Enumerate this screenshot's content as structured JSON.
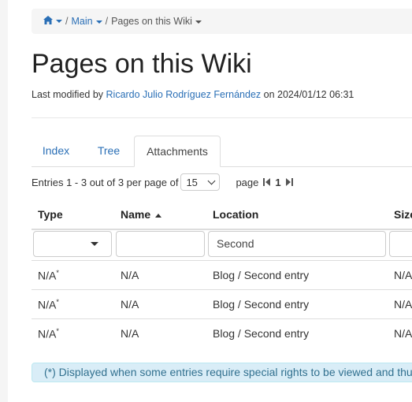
{
  "breadcrumb": {
    "home_label": "",
    "main_label": "Main",
    "current_label": "Pages on this Wiki",
    "separator": "/"
  },
  "page_title": "Pages on this Wiki",
  "modified": {
    "prefix": "Last modified by",
    "author": "Ricardo Julio Rodríguez Fernández",
    "on_label": "on",
    "timestamp": "2024/01/12 06:31"
  },
  "tabs": [
    {
      "label": "Index",
      "active": false
    },
    {
      "label": "Tree",
      "active": false
    },
    {
      "label": "Attachments",
      "active": true
    }
  ],
  "pagination": {
    "entries_text": "Entries 1 - 3 out of 3 per page of",
    "per_page": "15",
    "page_label": "page",
    "current_page": "1"
  },
  "table": {
    "columns": [
      {
        "label": "Type"
      },
      {
        "label": "Name",
        "sorted": "asc"
      },
      {
        "label": "Location"
      },
      {
        "label": "Size"
      }
    ],
    "filters": {
      "type": "",
      "name": "",
      "location": "Second",
      "size": ""
    },
    "rows": [
      {
        "type": "N/A",
        "type_mark": "*",
        "name": "N/A",
        "location": "Blog / Second entry",
        "size": "N/A"
      },
      {
        "type": "N/A",
        "type_mark": "*",
        "name": "N/A",
        "location": "Blog / Second entry",
        "size": "N/A"
      },
      {
        "type": "N/A",
        "type_mark": "*",
        "name": "N/A",
        "location": "Blog / Second entry",
        "size": "N/A"
      }
    ]
  },
  "note": "(*) Displayed when some entries require special rights to be viewed and thus are not",
  "colors": {
    "link": "#2a6fb6",
    "info_bg": "#d9edf7",
    "info_text": "#31708f"
  }
}
